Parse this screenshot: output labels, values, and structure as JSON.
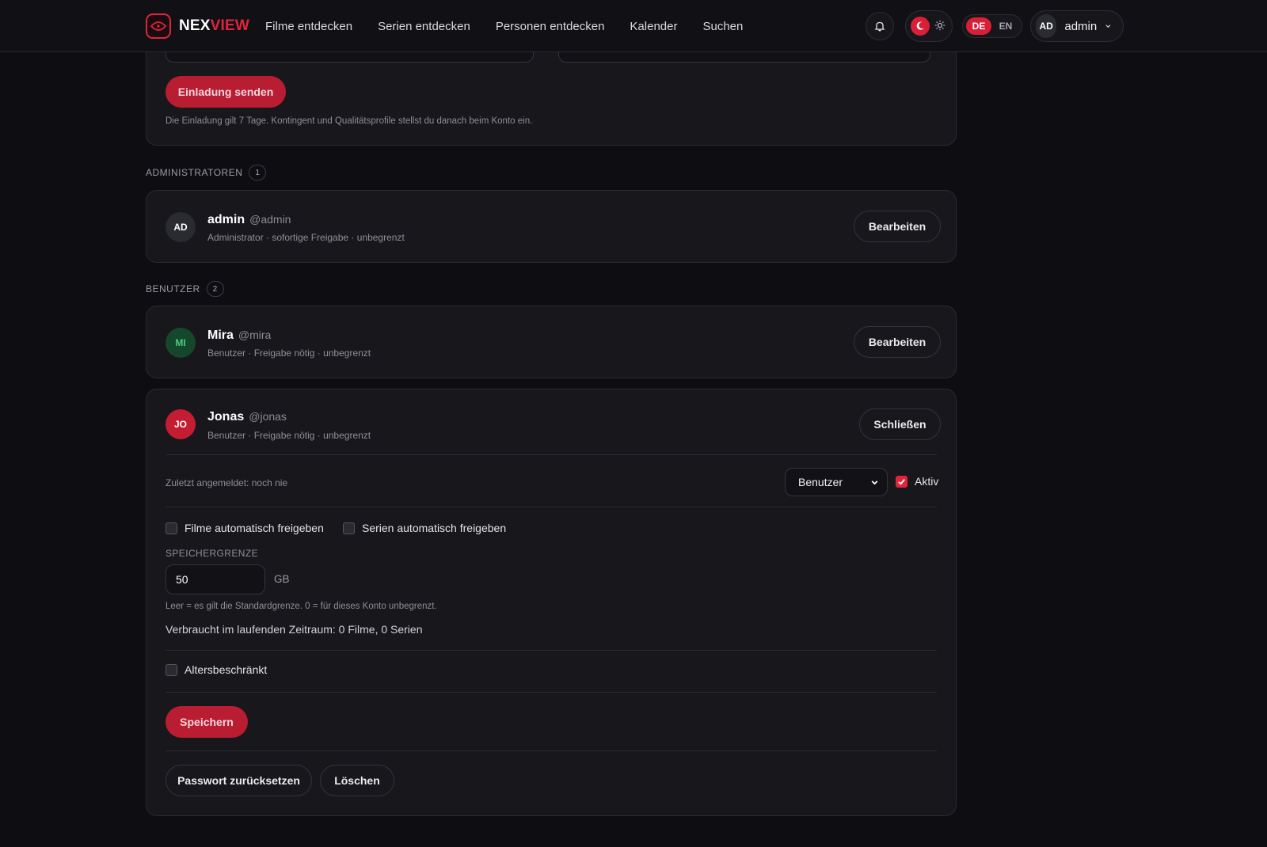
{
  "header": {
    "brand_part1": "NEX",
    "brand_part2": "VIEW",
    "nav": [
      "Filme entdecken",
      "Serien entdecken",
      "Personen entdecken",
      "Kalender",
      "Suchen"
    ],
    "lang_de": "DE",
    "lang_en": "EN",
    "user_initials": "AD",
    "user_name": "admin"
  },
  "invite": {
    "send_button": "Einladung senden",
    "hint": "Die Einladung gilt 7 Tage. Kontingent und Qualitätsprofile stellst du danach beim Konto ein."
  },
  "admins": {
    "label": "ADMINISTRATOREN",
    "count": "1",
    "users": [
      {
        "initials": "AD",
        "name": "admin",
        "handle": "@admin",
        "meta": "Administrator · sofortige Freigabe · unbegrenzt",
        "action": "Bearbeiten"
      }
    ]
  },
  "users": {
    "label": "BENUTZER",
    "count": "2",
    "list": [
      {
        "initials": "MI",
        "name": "Mira",
        "handle": "@mira",
        "meta": "Benutzer · Freigabe nötig · unbegrenzt",
        "action": "Bearbeiten"
      },
      {
        "initials": "JO",
        "name": "Jonas",
        "handle": "@jonas",
        "meta": "Benutzer · Freigabe nötig · unbegrenzt",
        "action": "Schließen"
      }
    ]
  },
  "editor": {
    "last_login": "Zuletzt angemeldet: noch nie",
    "role_value": "Benutzer",
    "active_label": "Aktiv",
    "auto_movies": "Filme automatisch freigeben",
    "auto_series": "Serien automatisch freigeben",
    "storage_label": "SPEICHERGRENZE",
    "storage_value": "50",
    "storage_unit": "GB",
    "storage_hint": "Leer = es gilt die Standardgrenze. 0 = für dieses Konto unbegrenzt.",
    "usage": "Verbraucht im laufenden Zeitraum: 0 Filme, 0 Serien",
    "age_restricted": "Altersbeschränkt",
    "save": "Speichern",
    "reset_password": "Passwort zurücksetzen",
    "delete": "Löschen"
  },
  "colors": {
    "accent": "#e0243b",
    "button_red": "#b81d32",
    "background": "#0e0e12",
    "card": "#17171c"
  }
}
